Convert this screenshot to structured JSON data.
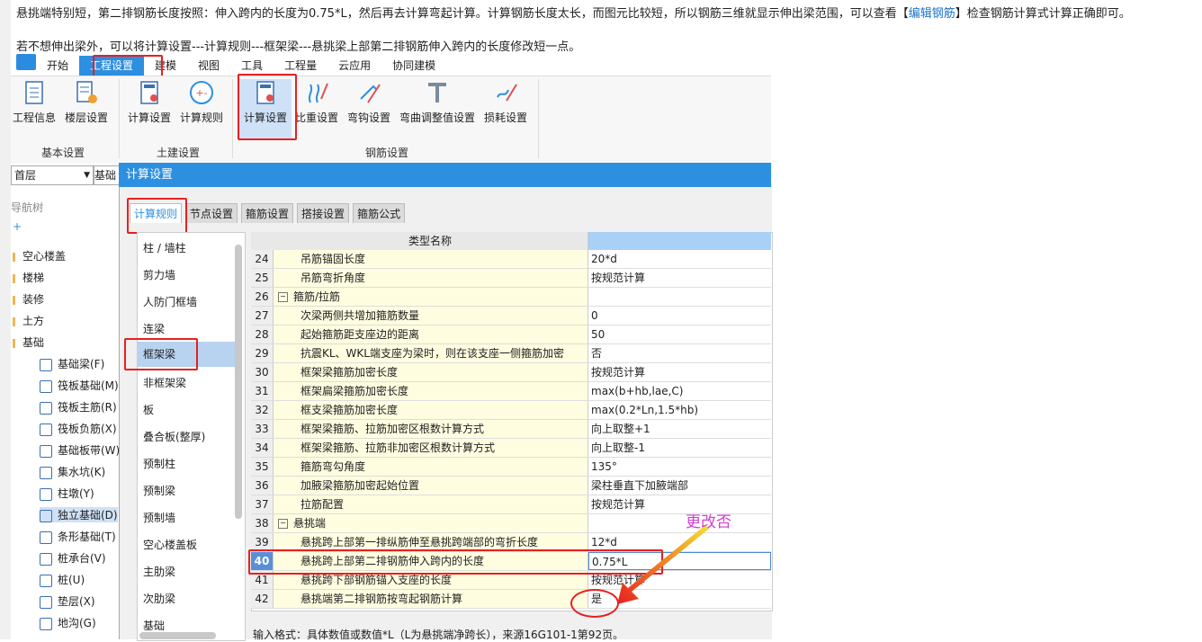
{
  "doc": {
    "line1_a": "悬挑端特别短，第二排钢筋长度按照：伸入跨内的长度为0.75*L，然后再去计算弯起计算。计算钢筋长度太长，而图元比较短，所以钢筋三维就显示伸出梁范围，可以查看【",
    "line1_link": "编辑钢筋",
    "line1_b": "】检查钢筋计算式计算正确即可。",
    "line2": "若不想伸出梁外，可以将计算设置---计算规则---框架梁---悬挑梁上部第二排钢筋伸入跨内的长度修改短一点。"
  },
  "menu": [
    "开始",
    "工程设置",
    "建模",
    "视图",
    "工具",
    "工程量",
    "云应用",
    "协同建模"
  ],
  "ribbon": {
    "basic": {
      "label": "基本设置",
      "buttons": [
        "工程信息",
        "楼层设置"
      ]
    },
    "civil": {
      "label": "土建设置",
      "buttons": [
        "计算设置",
        "计算规则"
      ]
    },
    "rebar": {
      "label": "钢筋设置",
      "buttons": [
        "计算设置",
        "比重设置",
        "弯钩设置",
        "弯曲调整值设置",
        "损耗设置"
      ]
    }
  },
  "left": {
    "floor_value": "首层",
    "base_label": "基础",
    "nav_title": "导航树",
    "nav_plus": "+",
    "items": [
      "空心楼盖",
      "楼梯",
      "装修",
      "土方",
      "基础"
    ],
    "sub_items": [
      "基础梁(F)",
      "筏板基础(M)",
      "筏板主筋(R)",
      "筏板负筋(X)",
      "基础板带(W)",
      "集水坑(K)",
      "柱墩(Y)",
      "独立基础(D)",
      "条形基础(T)",
      "桩承台(V)",
      "桩(U)",
      "垫层(X)",
      "地沟(G)"
    ]
  },
  "dialog": {
    "title": "计算设置",
    "tabs": [
      "计算规则",
      "节点设置",
      "箍筋设置",
      "搭接设置",
      "箍筋公式"
    ],
    "categories": [
      "柱 / 墙柱",
      "剪力墙",
      "人防门框墙",
      "连梁",
      "框架梁",
      "非框架梁",
      "板",
      "叠合板(整厚)",
      "预制柱",
      "预制梁",
      "预制墙",
      "空心楼盖板",
      "主肋梁",
      "次肋梁",
      "基础"
    ],
    "header_name": "类型名称",
    "rows": [
      {
        "num": "24",
        "name": "吊筋锚固长度",
        "val": "20*d"
      },
      {
        "num": "25",
        "name": "吊筋弯折角度",
        "val": "按规范计算"
      },
      {
        "num": "26",
        "name": "箍筋/拉筋",
        "val": "",
        "group": true
      },
      {
        "num": "27",
        "name": "次梁两侧共增加箍筋数量",
        "val": "0"
      },
      {
        "num": "28",
        "name": "起始箍筋距支座边的距离",
        "val": "50"
      },
      {
        "num": "29",
        "name": "抗震KL、WKL端支座为梁时，则在该支座一侧箍筋加密",
        "val": "否"
      },
      {
        "num": "30",
        "name": "框架梁箍筋加密长度",
        "val": "按规范计算"
      },
      {
        "num": "31",
        "name": "框架扁梁箍筋加密长度",
        "val": "max(b+hb,lae,C)"
      },
      {
        "num": "32",
        "name": "框支梁箍筋加密长度",
        "val": "max(0.2*Ln,1.5*hb)"
      },
      {
        "num": "33",
        "name": "框架梁箍筋、拉筋加密区根数计算方式",
        "val": "向上取整+1"
      },
      {
        "num": "34",
        "name": "框架梁箍筋、拉筋非加密区根数计算方式",
        "val": "向上取整-1"
      },
      {
        "num": "35",
        "name": "箍筋弯勾角度",
        "val": "135°"
      },
      {
        "num": "36",
        "name": "加腋梁箍筋加密起始位置",
        "val": "梁柱垂直下加腋端部"
      },
      {
        "num": "37",
        "name": "拉筋配置",
        "val": "按规范计算"
      },
      {
        "num": "38",
        "name": "悬挑端",
        "val": "",
        "group": true
      },
      {
        "num": "39",
        "name": "悬挑跨上部第一排纵筋伸至悬挑跨端部的弯折长度",
        "val": "12*d"
      },
      {
        "num": "40",
        "name": "悬挑跨上部第二排钢筋伸入跨内的长度",
        "val": "0.75*L",
        "selected": true
      },
      {
        "num": "41",
        "name": "悬挑跨下部钢筋锚入支座的长度",
        "val": "按规范计算"
      },
      {
        "num": "42",
        "name": "悬挑端第二排钢筋按弯起钢筋计算",
        "val": "是"
      }
    ],
    "hint": "输入格式：具体数值或数值*L（L为悬挑端净跨长），来源16G101-1第92页。"
  },
  "annotation": "更改否"
}
